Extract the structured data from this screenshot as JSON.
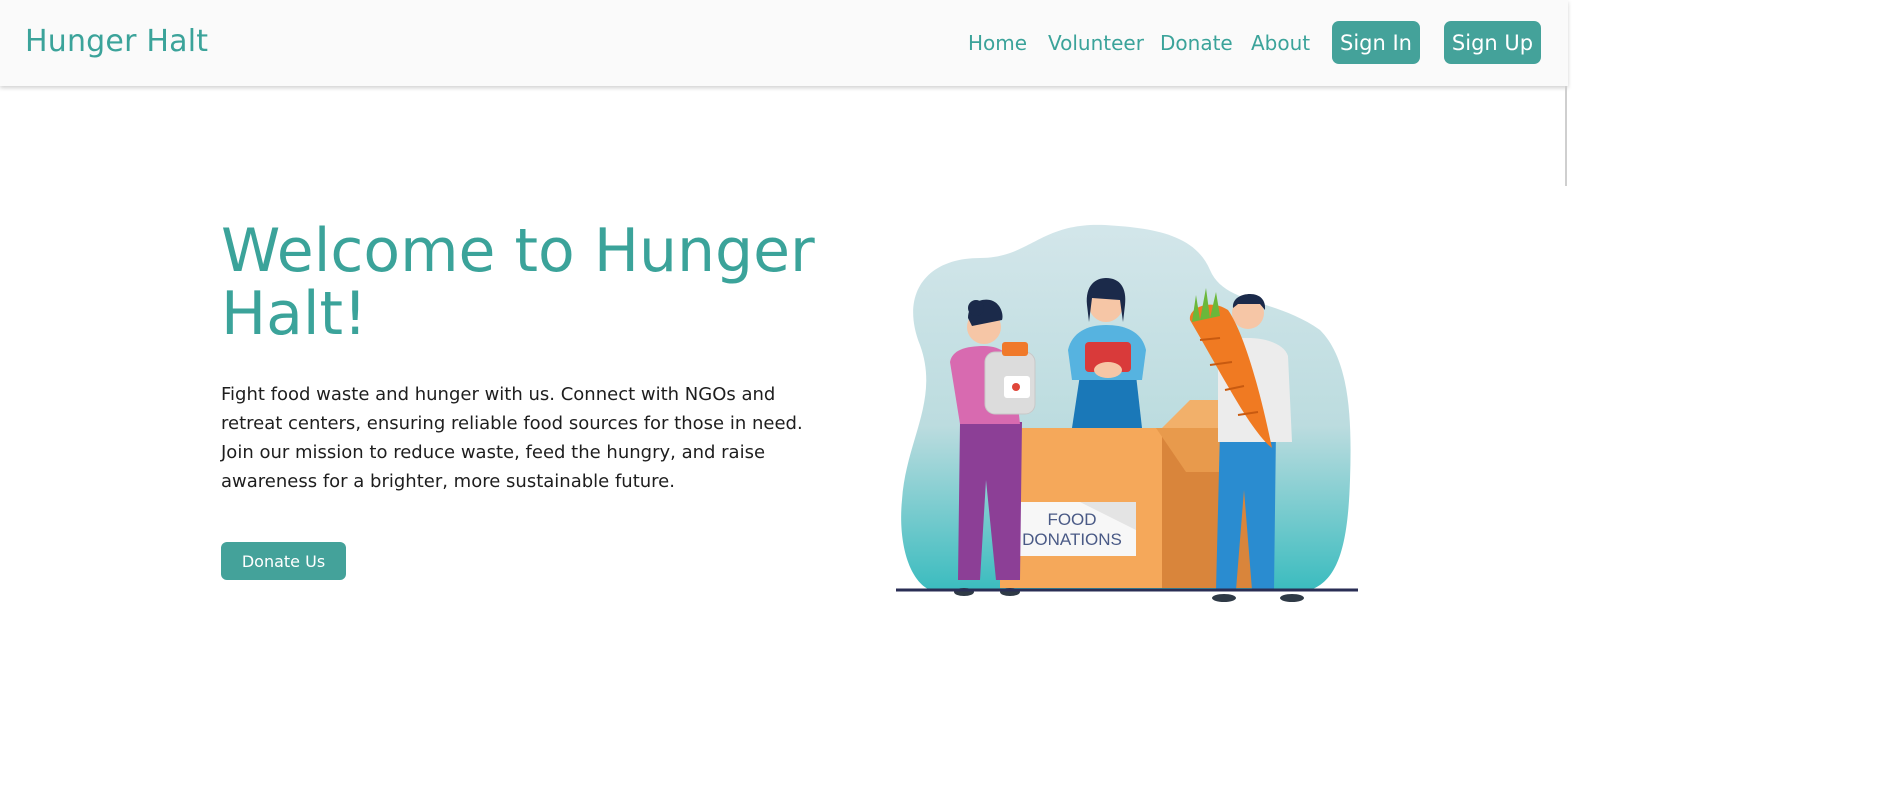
{
  "brand": "Hunger Halt",
  "nav": {
    "links": [
      "Home",
      "Volunteer",
      "Donate",
      "About"
    ],
    "sign_in": "Sign In",
    "sign_up": "Sign Up"
  },
  "hero": {
    "title": "Welcome to Hunger Halt!",
    "description": "Fight food waste and hunger with us. Connect with NGOs and retreat centers, ensuring reliable food sources for those in need. Join our mission to reduce waste, feed the hungry, and raise awareness for a brighter, more sustainable future.",
    "cta": "Donate Us"
  },
  "illustration": {
    "box_label_line1": "FOOD",
    "box_label_line2": "DONATIONS"
  },
  "colors": {
    "accent": "#3ba39a",
    "button": "#44a29a",
    "navbar_bg": "#fafafa"
  }
}
